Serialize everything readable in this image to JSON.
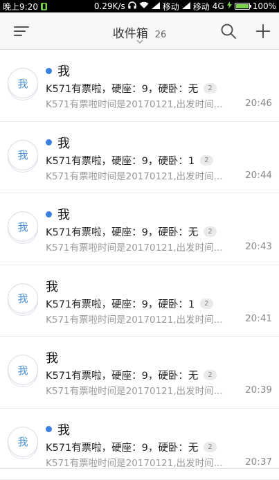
{
  "status_bar": {
    "time": "晚上9:20",
    "speed": "0.29K/s",
    "carrier1": "移动",
    "carrier2": "移动",
    "network": "4G",
    "battery": "100%",
    "battery_level": 1.0
  },
  "header": {
    "title": "收件箱",
    "count": "26",
    "icons": [
      "menu-icon",
      "chevron-down-icon",
      "search-icon",
      "add-icon"
    ]
  },
  "colors": {
    "accent": "#3b7fe0",
    "avatar_text": "#4a90d9",
    "preview": "#9a9a9a"
  },
  "messages": [
    {
      "sender": "我",
      "unread": true,
      "subject": "K571有票啦，硬座：9，硬卧：无",
      "thread_count": "2",
      "preview": "K571有票啦时间是20170121,出发时间...",
      "time": "20:46",
      "avatar": "我"
    },
    {
      "sender": "我",
      "unread": true,
      "subject": "K571有票啦，硬座：9，硬卧：1",
      "thread_count": "2",
      "preview": "K571有票啦时间是20170121,出发时间...",
      "time": "20:44",
      "avatar": "我"
    },
    {
      "sender": "我",
      "unread": true,
      "subject": "K571有票啦，硬座：9，硬卧：无",
      "thread_count": "2",
      "preview": "K571有票啦时间是20170121,出发时间...",
      "time": "20:43",
      "avatar": "我"
    },
    {
      "sender": "我",
      "unread": false,
      "subject": "K571有票啦，硬座：9，硬卧：1",
      "thread_count": "2",
      "preview": "K571有票啦时间是20170121,出发时间...",
      "time": "20:41",
      "avatar": "我"
    },
    {
      "sender": "我",
      "unread": false,
      "subject": "K571有票啦，硬座：9，硬卧：无",
      "thread_count": "2",
      "preview": "K571有票啦时间是20170121,出发时间...",
      "time": "20:39",
      "avatar": "我"
    },
    {
      "sender": "我",
      "unread": true,
      "subject": "K571有票啦，硬座：9，硬卧：无",
      "thread_count": "2",
      "preview": "K571有票啦时间是20170121,出发时间...",
      "time": "20:37",
      "avatar": "我"
    }
  ]
}
